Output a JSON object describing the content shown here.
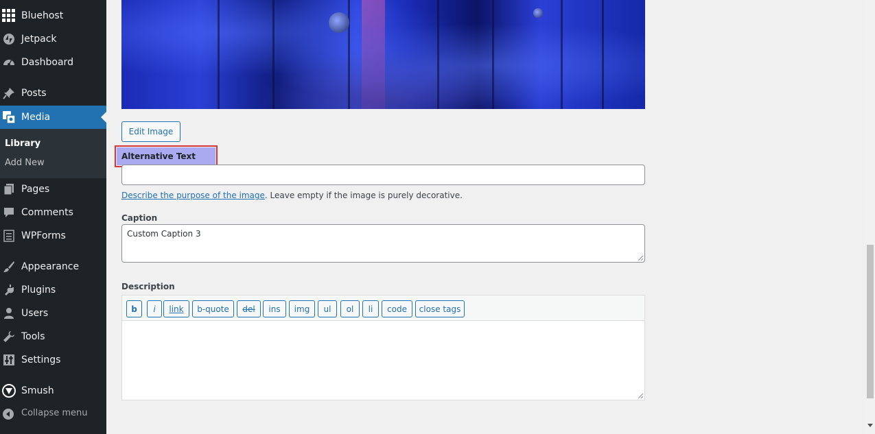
{
  "sidebar": {
    "items": [
      {
        "label": "Bluehost",
        "icon": "grid-icon"
      },
      {
        "label": "Jetpack",
        "icon": "jetpack-icon"
      },
      {
        "label": "Dashboard",
        "icon": "dashboard-icon"
      },
      {
        "label": "Posts",
        "icon": "pin-icon"
      },
      {
        "label": "Media",
        "icon": "media-icon",
        "active": true
      },
      {
        "label": "Pages",
        "icon": "pages-icon"
      },
      {
        "label": "Comments",
        "icon": "comment-icon"
      },
      {
        "label": "WPForms",
        "icon": "form-icon"
      },
      {
        "label": "Appearance",
        "icon": "brush-icon"
      },
      {
        "label": "Plugins",
        "icon": "plugin-icon"
      },
      {
        "label": "Users",
        "icon": "user-icon"
      },
      {
        "label": "Tools",
        "icon": "wrench-icon"
      },
      {
        "label": "Settings",
        "icon": "settings-icon"
      },
      {
        "label": "Smush",
        "icon": "smush-icon"
      }
    ],
    "submenu": [
      "Library",
      "Add New"
    ],
    "collapse_label": "Collapse menu"
  },
  "main": {
    "edit_image_label": "Edit Image",
    "alt_text": {
      "label": "Alternative Text",
      "value": "",
      "help_link": "Describe the purpose of the image",
      "help_rest": ". Leave empty if the image is purely decorative."
    },
    "caption": {
      "label": "Caption",
      "value": "Custom Caption 3"
    },
    "description": {
      "label": "Description",
      "value": "",
      "toolbar": [
        "b",
        "i",
        "link",
        "b-quote",
        "del",
        "ins",
        "img",
        "ul",
        "ol",
        "li",
        "code",
        "close tags"
      ]
    }
  },
  "colors": {
    "sidebar_bg": "#1d2327",
    "active_bg": "#2271b1",
    "highlight": "#aaaaf0",
    "highlight_border": "#d63638"
  }
}
